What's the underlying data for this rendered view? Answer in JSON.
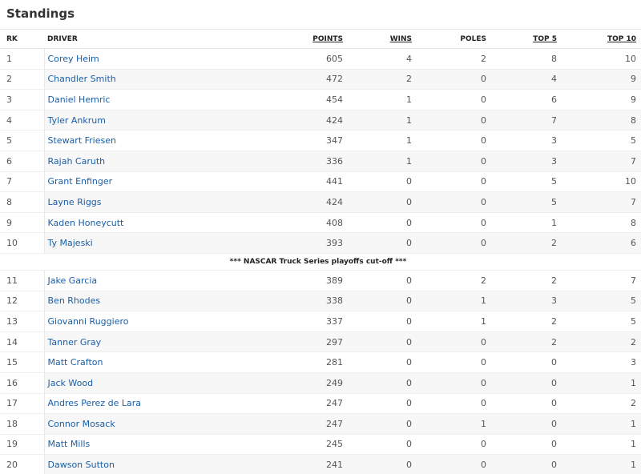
{
  "title": "Standings",
  "headers": {
    "rank": "RK",
    "driver": "DRIVER",
    "points": "POINTS",
    "wins": "WINS",
    "poles": "POLES",
    "top5": "TOP 5",
    "top10": "TOP 10"
  },
  "cutoff_label": "*** NASCAR Truck Series playoffs cut-off ***",
  "rows_top": [
    {
      "rank": "1",
      "driver": "Corey Heim",
      "points": "605",
      "wins": "4",
      "poles": "2",
      "top5": "8",
      "top10": "10"
    },
    {
      "rank": "2",
      "driver": "Chandler Smith",
      "points": "472",
      "wins": "2",
      "poles": "0",
      "top5": "4",
      "top10": "9"
    },
    {
      "rank": "3",
      "driver": "Daniel Hemric",
      "points": "454",
      "wins": "1",
      "poles": "0",
      "top5": "6",
      "top10": "9"
    },
    {
      "rank": "4",
      "driver": "Tyler Ankrum",
      "points": "424",
      "wins": "1",
      "poles": "0",
      "top5": "7",
      "top10": "8"
    },
    {
      "rank": "5",
      "driver": "Stewart Friesen",
      "points": "347",
      "wins": "1",
      "poles": "0",
      "top5": "3",
      "top10": "5"
    },
    {
      "rank": "6",
      "driver": "Rajah Caruth",
      "points": "336",
      "wins": "1",
      "poles": "0",
      "top5": "3",
      "top10": "7"
    },
    {
      "rank": "7",
      "driver": "Grant Enfinger",
      "points": "441",
      "wins": "0",
      "poles": "0",
      "top5": "5",
      "top10": "10"
    },
    {
      "rank": "8",
      "driver": "Layne Riggs",
      "points": "424",
      "wins": "0",
      "poles": "0",
      "top5": "5",
      "top10": "7"
    },
    {
      "rank": "9",
      "driver": "Kaden Honeycutt",
      "points": "408",
      "wins": "0",
      "poles": "0",
      "top5": "1",
      "top10": "8"
    },
    {
      "rank": "10",
      "driver": "Ty Majeski",
      "points": "393",
      "wins": "0",
      "poles": "0",
      "top5": "2",
      "top10": "6"
    }
  ],
  "rows_bottom": [
    {
      "rank": "11",
      "driver": "Jake Garcia",
      "points": "389",
      "wins": "0",
      "poles": "2",
      "top5": "2",
      "top10": "7"
    },
    {
      "rank": "12",
      "driver": "Ben Rhodes",
      "points": "338",
      "wins": "0",
      "poles": "1",
      "top5": "3",
      "top10": "5"
    },
    {
      "rank": "13",
      "driver": "Giovanni Ruggiero",
      "points": "337",
      "wins": "0",
      "poles": "1",
      "top5": "2",
      "top10": "5"
    },
    {
      "rank": "14",
      "driver": "Tanner Gray",
      "points": "297",
      "wins": "0",
      "poles": "0",
      "top5": "2",
      "top10": "2"
    },
    {
      "rank": "15",
      "driver": "Matt Crafton",
      "points": "281",
      "wins": "0",
      "poles": "0",
      "top5": "0",
      "top10": "3"
    },
    {
      "rank": "16",
      "driver": "Jack Wood",
      "points": "249",
      "wins": "0",
      "poles": "0",
      "top5": "0",
      "top10": "1"
    },
    {
      "rank": "17",
      "driver": "Andres Perez de Lara",
      "points": "247",
      "wins": "0",
      "poles": "0",
      "top5": "0",
      "top10": "2"
    },
    {
      "rank": "18",
      "driver": "Connor Mosack",
      "points": "247",
      "wins": "0",
      "poles": "1",
      "top5": "0",
      "top10": "1"
    },
    {
      "rank": "19",
      "driver": "Matt Mills",
      "points": "245",
      "wins": "0",
      "poles": "0",
      "top5": "0",
      "top10": "1"
    },
    {
      "rank": "20",
      "driver": "Dawson Sutton",
      "points": "241",
      "wins": "0",
      "poles": "0",
      "top5": "0",
      "top10": "1"
    }
  ]
}
